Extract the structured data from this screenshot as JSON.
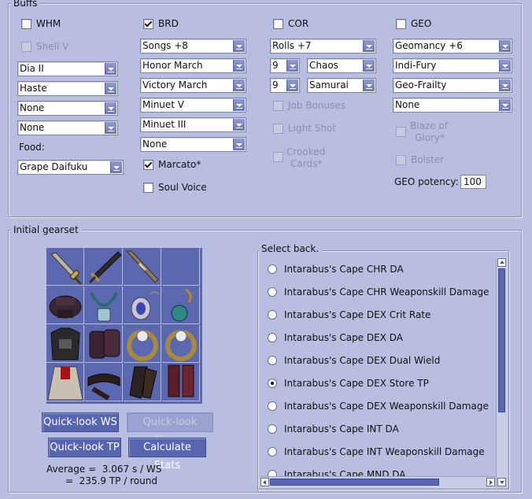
{
  "buffs": {
    "title": "Buffs",
    "whm": {
      "label": "WHM",
      "checked": false,
      "shell": "Shell V",
      "selects": [
        "Dia II",
        "Haste",
        "None",
        "None"
      ],
      "food_label": "Food:",
      "food": "Grape Daifuku"
    },
    "brd": {
      "label": "BRD",
      "checked": true,
      "selects": [
        "Songs +8",
        "Honor March",
        "Victory March",
        "Minuet V",
        "Minuet III",
        "None"
      ],
      "marcato": "Marcato*",
      "marcato_checked": true,
      "soul_voice": "Soul Voice"
    },
    "cor": {
      "label": "COR",
      "checked": false,
      "rolls": "Rolls +7",
      "roll1_num": "9",
      "roll1": "Chaos",
      "roll2_num": "9",
      "roll2": "Samurai",
      "job_bonuses": "Job Bonuses",
      "light_shot": "Light Shot",
      "crooked_line1": "Crooked",
      "crooked_line2": "Cards*"
    },
    "geo": {
      "label": "GEO",
      "checked": false,
      "selects": [
        "Geomancy +6",
        "Indi-Fury",
        "Geo-Frailty",
        "None"
      ],
      "blaze_line1": "Blaze of",
      "blaze_line2": "Glory*",
      "bolster": "Bolster",
      "potency_label": "GEO potency:",
      "potency": "100"
    }
  },
  "gearset": {
    "title": "Initial gearset",
    "buttons": {
      "ws": "Quick-look WS",
      "magic": "Quick-look Magic",
      "tp": "Quick-look TP",
      "calc": "Calculate Stats"
    },
    "avg_line1": "Average =  3.067 s / WS",
    "avg_line2": "=  235.9 TP / round",
    "colors": {
      "accent": "#5866b0",
      "slot_bg": "#5b68b0"
    }
  },
  "back": {
    "title": "Select back.",
    "selected_index": 5,
    "options": [
      "Intarabus's Cape CHR DA",
      "Intarabus's Cape CHR Weaponskill Damage",
      "Intarabus's Cape DEX Crit Rate",
      "Intarabus's Cape DEX DA",
      "Intarabus's Cape DEX Dual Wield",
      "Intarabus's Cape DEX Store TP",
      "Intarabus's Cape DEX Weaponskill Damage",
      "Intarabus's Cape INT DA",
      "Intarabus's Cape INT Weaponskill Damage",
      "Intarabus's Cape MND DA"
    ]
  }
}
